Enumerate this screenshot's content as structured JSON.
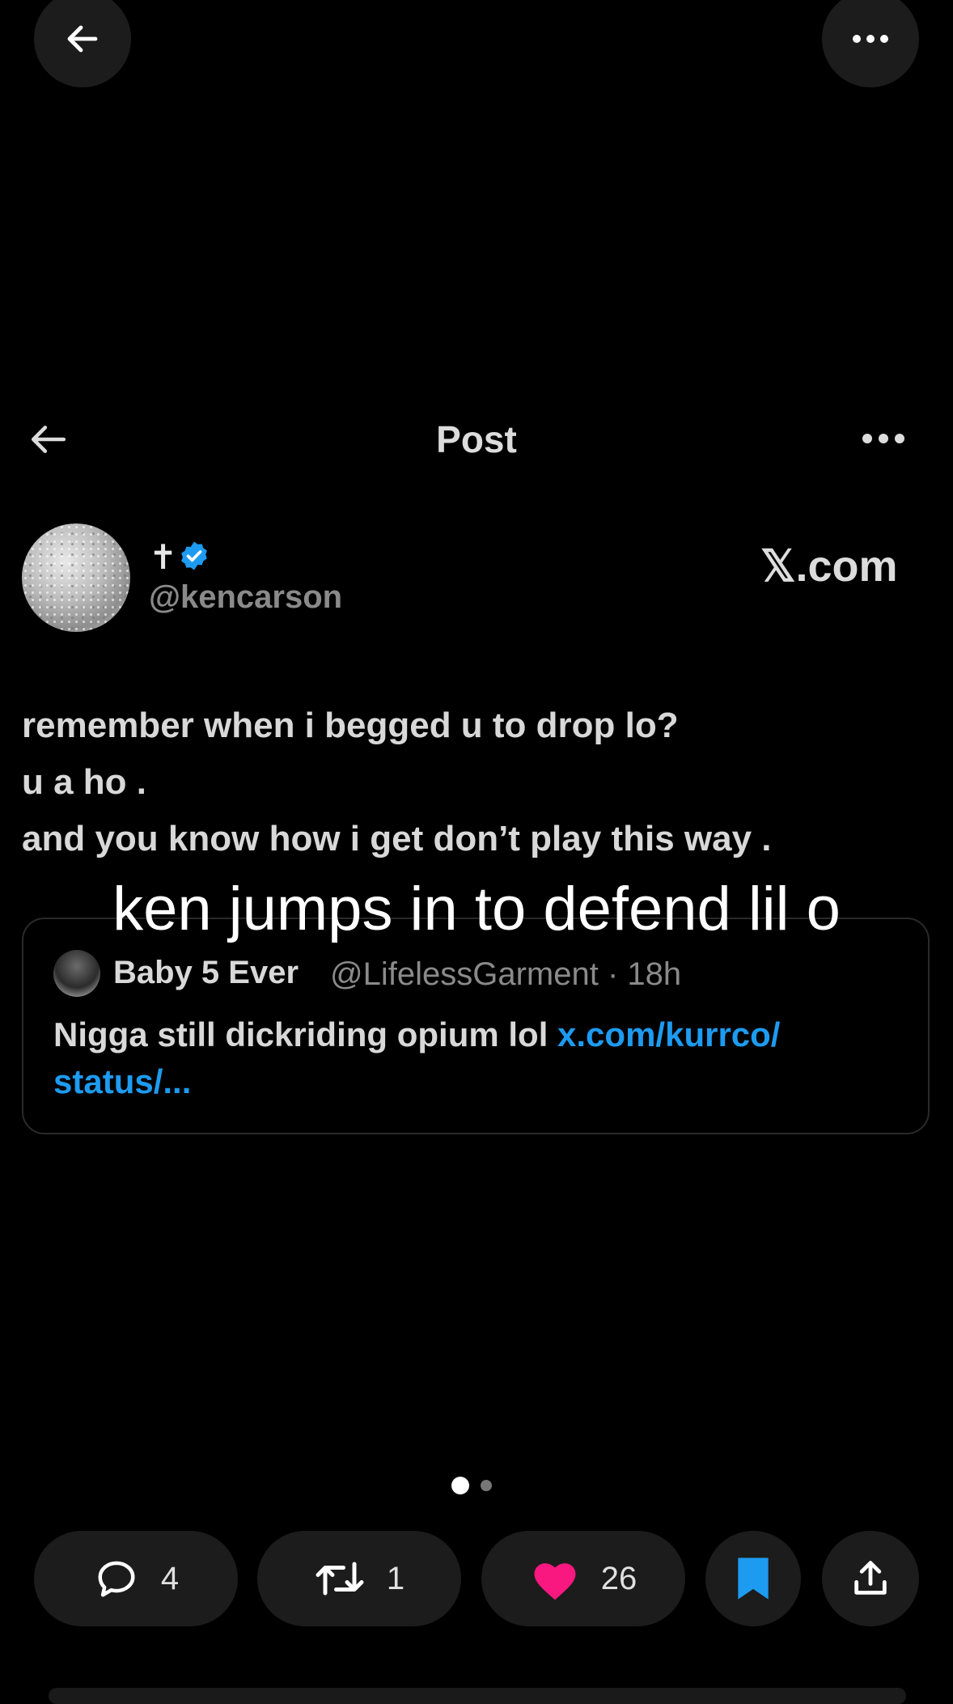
{
  "top_bar": {
    "back_icon": "arrow-left-icon",
    "more_icon": "more-horizontal-icon"
  },
  "post_header": {
    "title": "Post",
    "back_icon": "arrow-left-icon",
    "more_icon": "more-horizontal-icon"
  },
  "author": {
    "display_name": "✝",
    "handle": "@kencarson",
    "verified": true,
    "verified_color": "#1d9bf0"
  },
  "watermark": "𝕏.com",
  "tweet": {
    "lines": [
      "remember when i begged u to drop lo?",
      "u a ho .",
      "and you know how i get don’t play this way ."
    ]
  },
  "overlay_caption": "ken jumps in to defend lil o",
  "quote": {
    "name": "Baby 5 Ever",
    "handle_time": "@LifelessGarment · 18h",
    "text": "Nigga still dickriding opium lol ",
    "link": "x.com/kurrco/ status/..."
  },
  "pager": {
    "current": 1,
    "total": 2
  },
  "actions": {
    "reply_count": "4",
    "repost_count": "1",
    "like_count": "26",
    "like_color": "#f91880",
    "bookmark_color": "#1d9bf0"
  }
}
